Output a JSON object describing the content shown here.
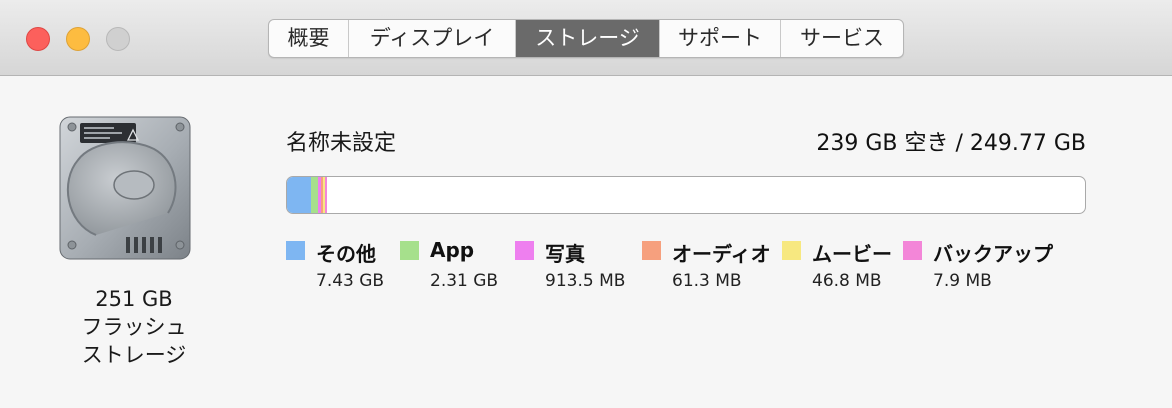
{
  "window": {
    "tabs": [
      {
        "label": "概要",
        "active": false
      },
      {
        "label": "ディスプレイ",
        "active": false
      },
      {
        "label": "ストレージ",
        "active": true
      },
      {
        "label": "サポート",
        "active": false
      },
      {
        "label": "サービス",
        "active": false
      }
    ]
  },
  "drive": {
    "icon": "hard-drive-icon",
    "caption_line1": "251 GB",
    "caption_line2": "フラッシュ",
    "caption_line3": "ストレージ"
  },
  "volume": {
    "name": "名称未設定",
    "capacity": "239 GB 空き / 249.77 GB",
    "total_gb": 249.77,
    "usage": [
      {
        "label": "その他",
        "size": "7.43 GB",
        "gb": 7.43,
        "color": "#7eb6f2"
      },
      {
        "label": "App",
        "size": "2.31 GB",
        "gb": 2.31,
        "color": "#a6e08c"
      },
      {
        "label": "写真",
        "size": "913.5 MB",
        "gb": 0.9135,
        "color": "#ee7fef"
      },
      {
        "label": "オーディオ",
        "size": "61.3 MB",
        "gb": 0.0613,
        "color": "#f6a07e"
      },
      {
        "label": "ムービー",
        "size": "46.8 MB",
        "gb": 0.0468,
        "color": "#f7e880"
      },
      {
        "label": "バックアップ",
        "size": "7.9 MB",
        "gb": 0.0079,
        "color": "#f386d8"
      }
    ]
  }
}
